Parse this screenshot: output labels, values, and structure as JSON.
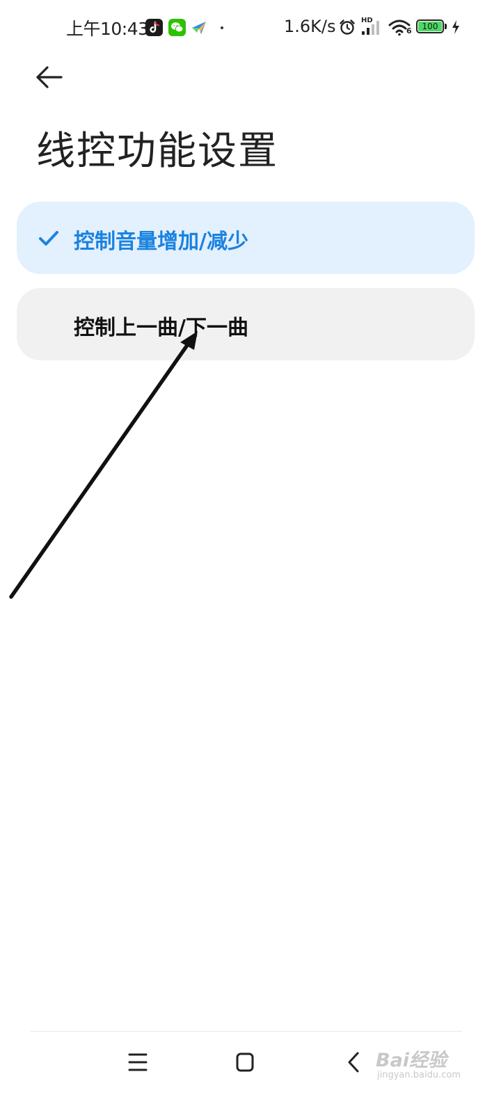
{
  "status_bar": {
    "time": "上午10:43",
    "app_icons": [
      "tiktok-icon",
      "wechat-icon",
      "app-icon"
    ],
    "network_speed": "1.6K/s",
    "hd_badge": "HD",
    "signal_label": "6",
    "battery_level": "100",
    "battery_color": "#4cd964"
  },
  "header": {
    "back_icon": "back-arrow-icon",
    "title": "线控功能设置"
  },
  "options": [
    {
      "label": "控制音量增加/减少",
      "selected": true
    },
    {
      "label": "控制上一曲/下一曲",
      "selected": false
    }
  ],
  "colors": {
    "accent": "#1a82e0",
    "selected_background": "#e3f0fd",
    "option_background": "#f1f1f1"
  },
  "nav_bar": {
    "icons": [
      "menu-icon",
      "home-icon",
      "back-icon"
    ]
  },
  "watermark": {
    "main": "Bai经验",
    "sub": "jingyan.baidu.com"
  }
}
